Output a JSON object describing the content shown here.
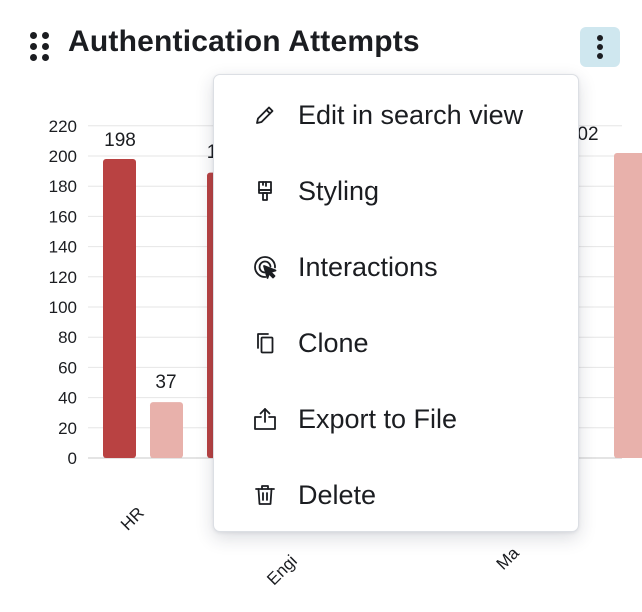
{
  "header": {
    "title": "Authentication Attempts"
  },
  "menu": {
    "items": [
      {
        "label": "Edit in search view",
        "icon": "pencil-icon"
      },
      {
        "label": "Styling",
        "icon": "paintbrush-icon"
      },
      {
        "label": "Interactions",
        "icon": "cursor-click-icon"
      },
      {
        "label": "Clone",
        "icon": "copy-icon"
      },
      {
        "label": "Export to File",
        "icon": "upload-icon"
      },
      {
        "label": "Delete",
        "icon": "trash-icon"
      }
    ]
  },
  "colors": {
    "bar_primary": "#b94242",
    "bar_secondary": "#e8b1ab",
    "menu_button_bg": "#cfe7ef",
    "gridline": "#e6e6e6"
  },
  "chart_data": {
    "type": "bar",
    "categories": [
      "HR",
      "Engi",
      "Ma"
    ],
    "series": [
      {
        "values": [
          198,
          189,
          null
        ]
      },
      {
        "values": [
          37,
          null,
          202
        ]
      }
    ],
    "data_labels": [
      "198",
      "37",
      "1",
      "02"
    ],
    "yticks": [
      0,
      20,
      40,
      60,
      80,
      100,
      120,
      140,
      160,
      180,
      200,
      220
    ],
    "ylim": [
      0,
      220
    ]
  }
}
